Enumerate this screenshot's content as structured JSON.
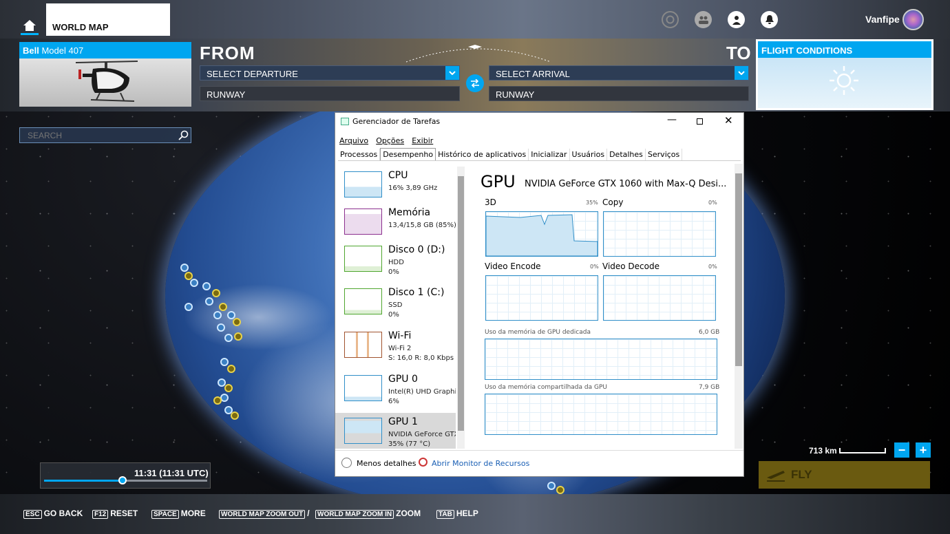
{
  "header": {
    "tab_world_map": "WORLD MAP",
    "username": "Vanfipe",
    "icons": [
      "home-icon",
      "achievements-icon",
      "friends-icon",
      "profile-icon",
      "notifications-icon"
    ]
  },
  "aircraft": {
    "brand": "Bell",
    "model": "Model 407"
  },
  "route": {
    "from_label": "FROM",
    "to_label": "TO",
    "departure_placeholder": "SELECT DEPARTURE",
    "arrival_placeholder": "SELECT ARRIVAL",
    "runway_from": "RUNWAY",
    "runway_to": "RUNWAY"
  },
  "conditions": {
    "title": "FLIGHT CONDITIONS",
    "icon": "sun-icon"
  },
  "search": {
    "placeholder": "SEARCH"
  },
  "task_manager": {
    "title": "Gerenciador de Tarefas",
    "menu": [
      "Arquivo",
      "Opções",
      "Exibir"
    ],
    "tabs": [
      "Processos",
      "Desempenho",
      "Histórico de aplicativos",
      "Inicializar",
      "Usuários",
      "Detalhes",
      "Serviços"
    ],
    "active_tab": "Desempenho",
    "sidebar": [
      {
        "name": "CPU",
        "line1": "16%  3,89 GHz",
        "line2": ""
      },
      {
        "name": "Memória",
        "line1": "13,4/15,8 GB (85%)",
        "line2": ""
      },
      {
        "name": "Disco 0 (D:)",
        "line1": "HDD",
        "line2": "0%"
      },
      {
        "name": "Disco 1 (C:)",
        "line1": "SSD",
        "line2": "0%"
      },
      {
        "name": "Wi-Fi",
        "line1": "Wi-Fi 2",
        "line2": "S: 16,0  R: 8,0 Kbps"
      },
      {
        "name": "GPU 0",
        "line1": "Intel(R) UHD Graphics",
        "line2": "6%"
      },
      {
        "name": "GPU 1",
        "line1": "NVIDIA GeForce GTX",
        "line2": "35%  (77 °C)"
      }
    ],
    "gpu": {
      "heading": "GPU",
      "model": "NVIDIA GeForce GTX 1060 with Max-Q Desi...",
      "engines": [
        {
          "label": "3D",
          "pct": "35%"
        },
        {
          "label": "Copy",
          "pct": "0%"
        },
        {
          "label": "Video Encode",
          "pct": "0%"
        },
        {
          "label": "Video Decode",
          "pct": "0%"
        }
      ],
      "dedicated_label": "Uso da memória de GPU dedicada",
      "dedicated_value": "6,0 GB",
      "shared_label": "Uso da memória compartilhada da GPU",
      "shared_value": "7,9 GB"
    },
    "footer": {
      "less_details": "Menos detalhes",
      "resource_monitor": "Abrir Monitor de Recursos"
    }
  },
  "time": {
    "display": "11:31 (11:31 UTC)",
    "slider_fraction": 0.48
  },
  "map": {
    "scale": "713 km",
    "zoom_out": "−",
    "zoom_in": "+"
  },
  "fly_button": "FLY",
  "hints": [
    {
      "key": "ESC",
      "label": "GO BACK"
    },
    {
      "key": "F12",
      "label": "RESET"
    },
    {
      "key": "SPACE",
      "label": "MORE"
    },
    {
      "key": "WORLD MAP ZOOM OUT",
      "label": "/"
    },
    {
      "key": "WORLD MAP ZOOM IN",
      "label": "ZOOM"
    },
    {
      "key": "TAB",
      "label": "HELP"
    }
  ],
  "colors": {
    "accent": "#00a6f0",
    "fly_disabled": "#6a5a10"
  }
}
